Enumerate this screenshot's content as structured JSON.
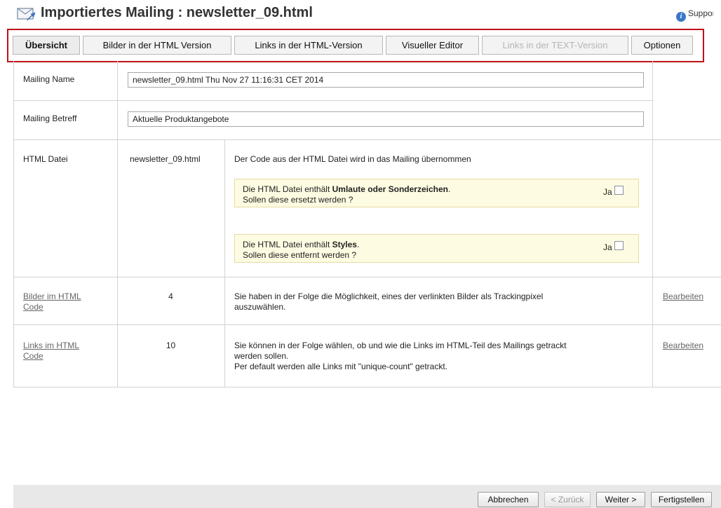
{
  "header": {
    "title": "Importiertes Mailing : newsletter_09.html",
    "support_label": "Support",
    "title_icon": "envelope-arrow-icon"
  },
  "tabs": [
    {
      "label": "Übersicht",
      "state": "active"
    },
    {
      "label": "Bilder in der HTML Version",
      "state": "normal"
    },
    {
      "label": "Links in der HTML-Version",
      "state": "normal"
    },
    {
      "label": "Visueller Editor",
      "state": "normal"
    },
    {
      "label": "Links in der TEXT-Version",
      "state": "disabled"
    },
    {
      "label": "Optionen",
      "state": "normal"
    }
  ],
  "form": {
    "mailing_name": {
      "label": "Mailing Name",
      "value": "newsletter_09.html Thu Nov 27 11:16:31 CET 2014"
    },
    "mailing_subject": {
      "label": "Mailing Betreff",
      "value": "Aktuelle Produktangebote"
    },
    "html_file": {
      "label": "HTML Datei",
      "filename": "newsletter_09.html",
      "description": "Der Code aus der HTML Datei wird in das Mailing übernommen",
      "notice_umlauts": {
        "line1_prefix": "Die HTML Datei enthält ",
        "line1_bold": "Umlaute oder Sonderzeichen",
        "line1_suffix": ".",
        "line2": "Sollen diese ersetzt werden ?",
        "checkbox_label": "Ja",
        "checked": false
      },
      "notice_styles": {
        "line1_prefix": "Die HTML Datei enthält ",
        "line1_bold": "Styles",
        "line1_suffix": ".",
        "line2": "Sollen diese entfernt werden ?",
        "checkbox_label": "Ja",
        "checked": false
      }
    },
    "images_row": {
      "label_line1": "Bilder im HTML",
      "label_line2": "Code",
      "count": "4",
      "desc_line1": "Sie haben in der Folge die Möglichkeit, eines der verlinkten Bilder als Trackingpixel",
      "desc_line2": "auszuwählen.",
      "action": "Bearbeiten"
    },
    "links_row": {
      "label_line1": "Links im HTML",
      "label_line2": "Code",
      "count": "10",
      "desc_line1": "Sie können in der Folge wählen, ob und wie die Links im HTML-Teil des Mailings getrackt",
      "desc_line2": "werden sollen.",
      "desc_line3": "Per default werden alle Links mit \"unique-count\" getrackt.",
      "action": "Bearbeiten"
    }
  },
  "footer": {
    "cancel": "Abbrechen",
    "back": "< Zurück",
    "next": "Weiter >",
    "finish": "Fertigstellen"
  },
  "colors": {
    "highlight_border": "#c0101a",
    "notice_background": "#fdfbe1",
    "footer_background": "#e8e8e8"
  }
}
